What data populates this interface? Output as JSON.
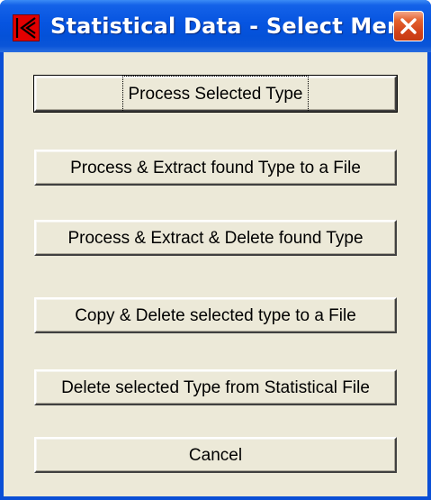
{
  "window": {
    "title": "Statistical Data - Select Menu",
    "icon": "app-k-logo-icon",
    "close_icon": "close-icon"
  },
  "colors": {
    "titlebar": "#0654e0",
    "client_bg": "#ece9d8",
    "close_button": "#d2421a",
    "app_icon_red": "#e10000"
  },
  "buttons": [
    {
      "label": "Process Selected Type",
      "default": true
    },
    {
      "label": "Process & Extract found Type to a File",
      "default": false
    },
    {
      "label": "Process & Extract & Delete found Type",
      "default": false
    },
    {
      "label": "Copy & Delete selected type to a File",
      "default": false
    },
    {
      "label": "Delete selected Type from Statistical File",
      "default": false
    },
    {
      "label": "Cancel",
      "default": false
    }
  ]
}
